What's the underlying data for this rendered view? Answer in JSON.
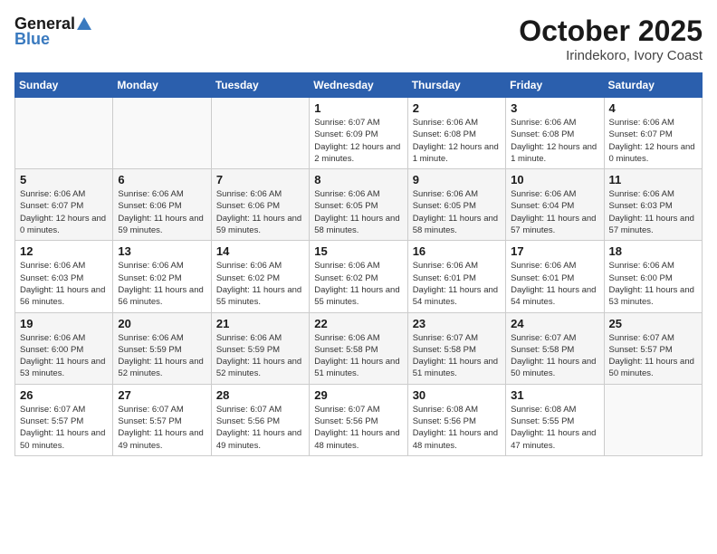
{
  "logo": {
    "general": "General",
    "blue": "Blue"
  },
  "title": "October 2025",
  "subtitle": "Irindekoro, Ivory Coast",
  "days_of_week": [
    "Sunday",
    "Monday",
    "Tuesday",
    "Wednesday",
    "Thursday",
    "Friday",
    "Saturday"
  ],
  "weeks": [
    [
      {
        "day": "",
        "info": ""
      },
      {
        "day": "",
        "info": ""
      },
      {
        "day": "",
        "info": ""
      },
      {
        "day": "1",
        "info": "Sunrise: 6:07 AM\nSunset: 6:09 PM\nDaylight: 12 hours and 2 minutes."
      },
      {
        "day": "2",
        "info": "Sunrise: 6:06 AM\nSunset: 6:08 PM\nDaylight: 12 hours and 1 minute."
      },
      {
        "day": "3",
        "info": "Sunrise: 6:06 AM\nSunset: 6:08 PM\nDaylight: 12 hours and 1 minute."
      },
      {
        "day": "4",
        "info": "Sunrise: 6:06 AM\nSunset: 6:07 PM\nDaylight: 12 hours and 0 minutes."
      }
    ],
    [
      {
        "day": "5",
        "info": "Sunrise: 6:06 AM\nSunset: 6:07 PM\nDaylight: 12 hours and 0 minutes."
      },
      {
        "day": "6",
        "info": "Sunrise: 6:06 AM\nSunset: 6:06 PM\nDaylight: 11 hours and 59 minutes."
      },
      {
        "day": "7",
        "info": "Sunrise: 6:06 AM\nSunset: 6:06 PM\nDaylight: 11 hours and 59 minutes."
      },
      {
        "day": "8",
        "info": "Sunrise: 6:06 AM\nSunset: 6:05 PM\nDaylight: 11 hours and 58 minutes."
      },
      {
        "day": "9",
        "info": "Sunrise: 6:06 AM\nSunset: 6:05 PM\nDaylight: 11 hours and 58 minutes."
      },
      {
        "day": "10",
        "info": "Sunrise: 6:06 AM\nSunset: 6:04 PM\nDaylight: 11 hours and 57 minutes."
      },
      {
        "day": "11",
        "info": "Sunrise: 6:06 AM\nSunset: 6:03 PM\nDaylight: 11 hours and 57 minutes."
      }
    ],
    [
      {
        "day": "12",
        "info": "Sunrise: 6:06 AM\nSunset: 6:03 PM\nDaylight: 11 hours and 56 minutes."
      },
      {
        "day": "13",
        "info": "Sunrise: 6:06 AM\nSunset: 6:02 PM\nDaylight: 11 hours and 56 minutes."
      },
      {
        "day": "14",
        "info": "Sunrise: 6:06 AM\nSunset: 6:02 PM\nDaylight: 11 hours and 55 minutes."
      },
      {
        "day": "15",
        "info": "Sunrise: 6:06 AM\nSunset: 6:02 PM\nDaylight: 11 hours and 55 minutes."
      },
      {
        "day": "16",
        "info": "Sunrise: 6:06 AM\nSunset: 6:01 PM\nDaylight: 11 hours and 54 minutes."
      },
      {
        "day": "17",
        "info": "Sunrise: 6:06 AM\nSunset: 6:01 PM\nDaylight: 11 hours and 54 minutes."
      },
      {
        "day": "18",
        "info": "Sunrise: 6:06 AM\nSunset: 6:00 PM\nDaylight: 11 hours and 53 minutes."
      }
    ],
    [
      {
        "day": "19",
        "info": "Sunrise: 6:06 AM\nSunset: 6:00 PM\nDaylight: 11 hours and 53 minutes."
      },
      {
        "day": "20",
        "info": "Sunrise: 6:06 AM\nSunset: 5:59 PM\nDaylight: 11 hours and 52 minutes."
      },
      {
        "day": "21",
        "info": "Sunrise: 6:06 AM\nSunset: 5:59 PM\nDaylight: 11 hours and 52 minutes."
      },
      {
        "day": "22",
        "info": "Sunrise: 6:06 AM\nSunset: 5:58 PM\nDaylight: 11 hours and 51 minutes."
      },
      {
        "day": "23",
        "info": "Sunrise: 6:07 AM\nSunset: 5:58 PM\nDaylight: 11 hours and 51 minutes."
      },
      {
        "day": "24",
        "info": "Sunrise: 6:07 AM\nSunset: 5:58 PM\nDaylight: 11 hours and 50 minutes."
      },
      {
        "day": "25",
        "info": "Sunrise: 6:07 AM\nSunset: 5:57 PM\nDaylight: 11 hours and 50 minutes."
      }
    ],
    [
      {
        "day": "26",
        "info": "Sunrise: 6:07 AM\nSunset: 5:57 PM\nDaylight: 11 hours and 50 minutes."
      },
      {
        "day": "27",
        "info": "Sunrise: 6:07 AM\nSunset: 5:57 PM\nDaylight: 11 hours and 49 minutes."
      },
      {
        "day": "28",
        "info": "Sunrise: 6:07 AM\nSunset: 5:56 PM\nDaylight: 11 hours and 49 minutes."
      },
      {
        "day": "29",
        "info": "Sunrise: 6:07 AM\nSunset: 5:56 PM\nDaylight: 11 hours and 48 minutes."
      },
      {
        "day": "30",
        "info": "Sunrise: 6:08 AM\nSunset: 5:56 PM\nDaylight: 11 hours and 48 minutes."
      },
      {
        "day": "31",
        "info": "Sunrise: 6:08 AM\nSunset: 5:55 PM\nDaylight: 11 hours and 47 minutes."
      },
      {
        "day": "",
        "info": ""
      }
    ]
  ]
}
